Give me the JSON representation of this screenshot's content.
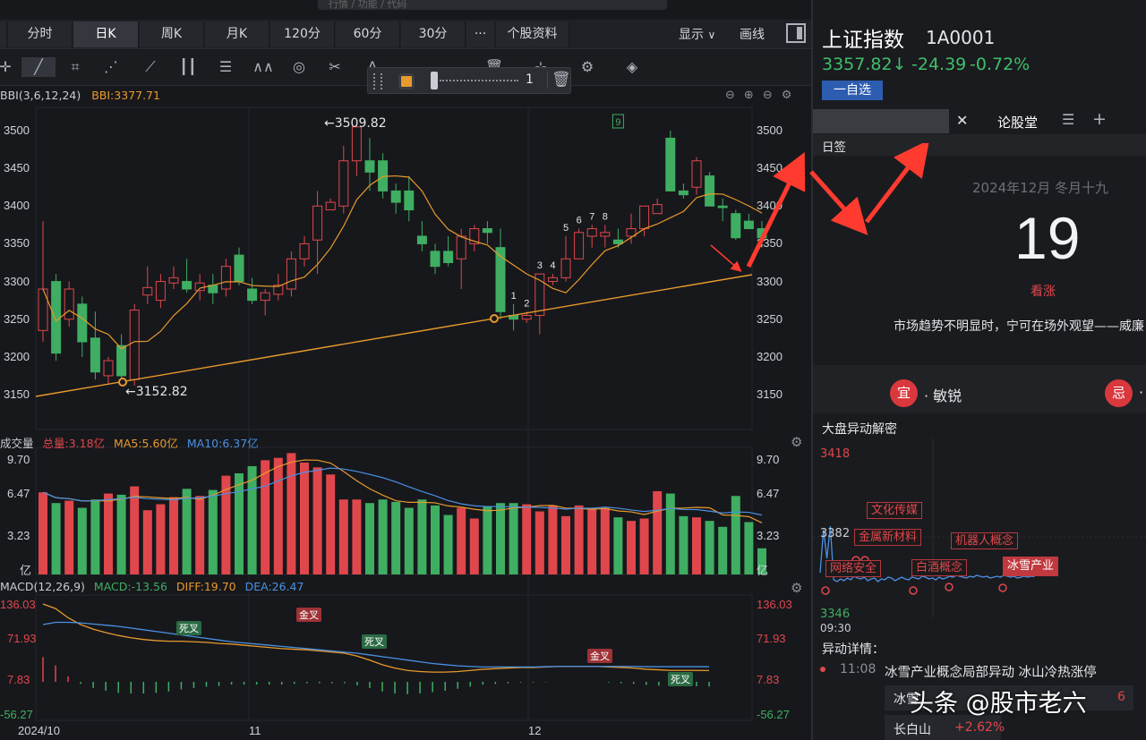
{
  "search": {
    "placeholder": "行情 / 功能 / 代码"
  },
  "toolbar": {
    "tabs": [
      "分时",
      "日K",
      "周K",
      "月K",
      "120分",
      "60分",
      "30分",
      "···",
      "个股资料"
    ],
    "active_tab": "日K",
    "display_label": "显示",
    "draw_label": "画线",
    "popup_value": "1"
  },
  "main": {
    "indicator_label": "BBI(3,6,12,24)",
    "indicator_value": "BBI:3377.71",
    "price_axis": [
      "3500",
      "3450",
      "3400",
      "3350",
      "3300",
      "3250",
      "3200",
      "3150"
    ],
    "high_marker": "←3509.82",
    "low_marker": "←3152.82",
    "td_counts": [
      "1",
      "2",
      "3",
      "4",
      "5",
      "6",
      "7",
      "8",
      "9"
    ]
  },
  "volume": {
    "label": "成交量",
    "total": "总量:3.18亿",
    "ma5": "MA5:5.60亿",
    "ma10": "MA10:6.37亿",
    "axis": [
      "9.70",
      "6.47",
      "3.23",
      "亿"
    ]
  },
  "macd": {
    "label": "MACD(12,26,9)",
    "macd": "MACD:-13.56",
    "diff": "DIFF:19.70",
    "dea": "DEA:26.47",
    "axis": [
      "136.03",
      "71.93",
      "7.83",
      "-56.27"
    ],
    "signals": [
      "死叉",
      "金叉",
      "死叉",
      "金叉",
      "死叉"
    ]
  },
  "dates": [
    "2024/10",
    "11",
    "12"
  ],
  "colors": {
    "up": "#e0474c",
    "down": "#3fae62",
    "bbi": "#e89a2c",
    "ma10": "#4a90e2",
    "accent": "#ff3b30"
  },
  "right": {
    "index_name": "上证指数",
    "index_code": "1A0001",
    "price": "3357.82↓",
    "change": "-24.39",
    "change_pct": "-0.72%",
    "watch_button": "一自选",
    "tab_forum": "论股堂",
    "section_daily": "日签",
    "date_line": "2024年12月 冬月十九",
    "day_number": "19",
    "sentiment": "看涨",
    "quote": "市场趋势不明显时，宁可在场外观望——威廉",
    "yi_label": "宜",
    "yi_text": "· 敏锐",
    "ji_label": "忌",
    "ji_text": "·",
    "anomaly_title": "大盘异动解密",
    "anomaly_axis": [
      "3418",
      "3382",
      "3346"
    ],
    "anomaly_time": "09:30",
    "tags": [
      "文化传媒",
      "金属新材料",
      "网络安全",
      "白酒概念",
      "机器人概念",
      "冰雪产业"
    ],
    "detail_title": "异动详情：",
    "detail_time": "11:08",
    "detail_text": "冰雪产业概念局部异动 冰山冷热涨停",
    "row1_name": "冰雪",
    "row1_val": "6",
    "row2_name": "长白山",
    "row2_val": "+2.62%"
  },
  "watermark": "头条 @股市老六",
  "chart_data": {
    "type": "candlestick",
    "x_labels": [
      "2024/10",
      "11",
      "12"
    ],
    "ylim": [
      3130,
      3530
    ],
    "ohlc": [
      [
        3235,
        3380,
        3220,
        3290
      ],
      [
        3300,
        3310,
        3195,
        3205
      ],
      [
        3250,
        3300,
        3240,
        3290
      ],
      [
        3270,
        3280,
        3200,
        3220
      ],
      [
        3225,
        3260,
        3170,
        3180
      ],
      [
        3175,
        3200,
        3165,
        3195
      ],
      [
        3215,
        3230,
        3170,
        3175
      ],
      [
        3170,
        3270,
        3162,
        3262
      ],
      [
        3282,
        3320,
        3270,
        3292
      ],
      [
        3275,
        3310,
        3265,
        3300
      ],
      [
        3298,
        3320,
        3290,
        3305
      ],
      [
        3300,
        3330,
        3285,
        3290
      ],
      [
        3288,
        3310,
        3275,
        3298
      ],
      [
        3295,
        3310,
        3270,
        3285
      ],
      [
        3290,
        3330,
        3280,
        3320
      ],
      [
        3335,
        3345,
        3295,
        3300
      ],
      [
        3290,
        3305,
        3270,
        3275
      ],
      [
        3275,
        3290,
        3255,
        3285
      ],
      [
        3283,
        3310,
        3275,
        3295
      ],
      [
        3290,
        3340,
        3280,
        3330
      ],
      [
        3330,
        3360,
        3320,
        3350
      ],
      [
        3355,
        3420,
        3310,
        3400
      ],
      [
        3395,
        3410,
        3395,
        3405
      ],
      [
        3400,
        3480,
        3390,
        3460
      ],
      [
        3460,
        3510,
        3440,
        3505
      ],
      [
        3460,
        3490,
        3420,
        3445
      ],
      [
        3460,
        3470,
        3410,
        3420
      ],
      [
        3420,
        3430,
        3390,
        3405
      ],
      [
        3420,
        3440,
        3380,
        3395
      ],
      [
        3360,
        3380,
        3340,
        3350
      ],
      [
        3340,
        3350,
        3310,
        3320
      ],
      [
        3340,
        3360,
        3320,
        3325
      ],
      [
        3330,
        3370,
        3290,
        3360
      ],
      [
        3350,
        3375,
        3340,
        3370
      ],
      [
        3370,
        3380,
        3350,
        3365
      ],
      [
        3345,
        3370,
        3250,
        3260
      ],
      [
        3255,
        3270,
        3235,
        3250
      ],
      [
        3250,
        3260,
        3245,
        3255
      ],
      [
        3255,
        3310,
        3230,
        3310
      ],
      [
        3300,
        3310,
        3295,
        3305
      ],
      [
        3305,
        3360,
        3300,
        3330
      ],
      [
        3330,
        3370,
        3330,
        3365
      ],
      [
        3360,
        3375,
        3345,
        3370
      ],
      [
        3360,
        3375,
        3345,
        3365
      ],
      [
        3355,
        3370,
        3345,
        3350
      ],
      [
        3360,
        3390,
        3350,
        3370
      ],
      [
        3370,
        3400,
        3360,
        3400
      ],
      [
        3390,
        3410,
        3390,
        3402
      ],
      [
        3490,
        3500,
        3420,
        3420
      ],
      [
        3420,
        3430,
        3410,
        3415
      ],
      [
        3425,
        3465,
        3415,
        3460
      ],
      [
        3440,
        3445,
        3400,
        3400
      ],
      [
        3400,
        3410,
        3380,
        3398
      ],
      [
        3390,
        3395,
        3355,
        3358
      ],
      [
        3380,
        3390,
        3370,
        3370
      ],
      [
        3370,
        3380,
        3345,
        3358
      ]
    ],
    "volume": [
      6.9,
      6.0,
      6.2,
      5.6,
      6.3,
      6.8,
      6.7,
      7.4,
      5.4,
      5.9,
      6.5,
      7.2,
      6.6,
      7.1,
      8.3,
      8.5,
      9.1,
      9.6,
      9.8,
      10.2,
      9.4,
      9.0,
      8.4,
      6.3,
      6.3,
      6.0,
      6.3,
      6.1,
      5.6,
      6.3,
      5.8,
      5.0,
      5.6,
      4.7,
      5.7,
      6.0,
      6.0,
      5.9,
      5.3,
      5.8,
      4.9,
      5.8,
      5.6,
      5.6,
      4.8,
      4.5,
      4.7,
      7.0,
      6.8,
      4.9,
      4.8,
      4.5,
      4.0,
      6.6,
      4.4,
      2.2
    ],
    "macd_dif": [
      136,
      128,
      112,
      100,
      92,
      86,
      81,
      77,
      74,
      72,
      71,
      71,
      70,
      69,
      67,
      66,
      64,
      62,
      60,
      58,
      57,
      56,
      54,
      52,
      50,
      45,
      38,
      30,
      24,
      20,
      18,
      17,
      17,
      18,
      20,
      22,
      23,
      24,
      25,
      25,
      26,
      27,
      27,
      27,
      27,
      26,
      25,
      24,
      22,
      21,
      20,
      20,
      20,
      19.7
    ],
    "macd_dea": [
      100,
      104,
      104,
      103,
      101,
      99,
      97,
      94,
      91,
      88,
      85,
      82,
      79,
      76,
      73,
      70,
      68,
      66,
      64,
      62,
      60,
      58,
      56,
      54,
      52,
      50,
      47,
      44,
      41,
      38,
      35,
      32,
      30,
      28,
      27,
      26,
      26,
      26,
      26,
      26,
      26.5,
      27,
      27,
      27,
      27,
      27,
      27,
      27,
      26.5,
      26.5,
      26.5,
      26.5,
      26.5,
      26.47
    ],
    "bbi_value": 3377.71
  }
}
